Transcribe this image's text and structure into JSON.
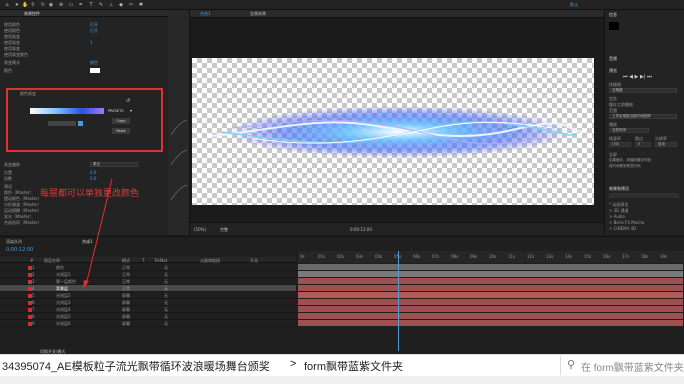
{
  "toolbar": {
    "left_icons": [
      "home-icon",
      "arrow-icon",
      "hand-icon",
      "zoom-icon",
      "rotate-icon",
      "camera-icon",
      "pan-icon",
      "rect-icon",
      "pen-icon",
      "text-icon",
      "brush-icon",
      "stamp-icon",
      "eraser-icon",
      "roto-icon",
      "puppet-icon"
    ],
    "right_label": "默认"
  },
  "effects": {
    "tab_label": "效果控件",
    "rows": [
      {
        "label": "使用颜色",
        "value": "打开"
      },
      {
        "label": "使用颜色",
        "value": "打开"
      },
      {
        "label": "使用渐变",
        "value": ""
      },
      {
        "label": "使用渐变",
        "value": "1"
      },
      {
        "label": "使用渐变",
        "value": ""
      },
      {
        "label": "使用渐变颜色",
        "value": ""
      },
      {
        "label": "渐变模式",
        "value": "颜色"
      },
      {
        "label": "颜色",
        "value": ""
      }
    ],
    "gradient_label": "颜色渐变",
    "presets_label": "PRESETS",
    "copy_label": "Copy",
    "paste_label": "Paste",
    "lower_rows": [
      {
        "label": "渐变偏移",
        "value": "0.0"
      },
      {
        "label": "位置",
        "value": "0.0"
      },
      {
        "label": "倍数",
        "value": "0.0"
      },
      {
        "label": "预设",
        "value": ""
      },
      {
        "label": "颜色（Master）",
        "value": ""
      },
      {
        "label": "摆动颜色（Master）",
        "value": ""
      },
      {
        "label": "分形噪波（Master）",
        "value": ""
      },
      {
        "label": "运动模糊（Master）",
        "value": ""
      },
      {
        "label": "发光（Master）",
        "value": ""
      },
      {
        "label": "合成选项（Master）",
        "value": ""
      }
    ],
    "select_value": "柔光"
  },
  "annotation": "每层都可以单独更改颜色",
  "composition": {
    "tab": "合成1",
    "tab2": "金属效果",
    "zoom": "(50%)",
    "quality": "完整",
    "timecode": "0:00:12:00"
  },
  "right_panel": {
    "info_title": "信息",
    "audio_title": "音频",
    "preview_title": "预览",
    "shortcut_label": "快捷键",
    "shortcut_value": "空格键",
    "include_label": "包含",
    "cache_label": "缓存之前播放",
    "range_label": "范围",
    "range_value": "工作区域按当前时间延伸",
    "play_label": "播放",
    "play_value": "当前时间",
    "fps_label": "帧速率",
    "fps_value": "(30)",
    "skip_label": "跳过",
    "skip_value": "0",
    "res_label": "分辨率",
    "res_value": "自动",
    "fullscreen_label": "全屏",
    "stop_label": "如果缓存，则播放缓存的帧",
    "move_label": "将时间移到预览时间",
    "effects_title": "效果和预设",
    "effects_items": [
      "* 动画预设",
      "> 3D 通道",
      "> Audio",
      "> Boris FX Mocha",
      "> CINEMA 4D"
    ]
  },
  "timeline": {
    "project_tab": "渲染队列",
    "comp_tab": "合成1",
    "timecode": "0:00:12:00",
    "header": [
      "#",
      "图层名称",
      "模式",
      "T",
      "TrkMat",
      "父级和链接",
      "开关"
    ],
    "layers": [
      {
        "num": "1",
        "name": "颜色",
        "mode": "正常",
        "parent": "无"
      },
      {
        "num": "2",
        "name": "光线层1",
        "mode": "正常",
        "parent": "无"
      },
      {
        "num": "3",
        "name": "第一层颜色",
        "mode": "正常",
        "parent": "无"
      },
      {
        "num": "4",
        "name": "背景层",
        "mode": "正常",
        "parent": "无"
      },
      {
        "num": "5",
        "name": "光线层2",
        "mode": "屏幕",
        "parent": "无"
      },
      {
        "num": "6",
        "name": "光线层3",
        "mode": "屏幕",
        "parent": "无"
      },
      {
        "num": "7",
        "name": "光线层4",
        "mode": "屏幕",
        "parent": "无"
      },
      {
        "num": "8",
        "name": "光线层5",
        "mode": "屏幕",
        "parent": "无"
      },
      {
        "num": "9",
        "name": "光线层6",
        "mode": "屏幕",
        "parent": "无"
      }
    ],
    "ruler": [
      "0s",
      "01s",
      "02s",
      "03s",
      "04s",
      "05s",
      "06s",
      "07s",
      "08s",
      "09s",
      "10s",
      "11s",
      "12s",
      "13s",
      "14s",
      "15s",
      "16s",
      "17s",
      "18s",
      "19s",
      "20s"
    ],
    "footer": "切换开关/模式"
  },
  "path": {
    "folder1": "34395074_AE模板粒子流光飘带循环波浪暖场舞台颁奖",
    "sep": ">",
    "folder2": "form飘带蓝紫文件夹",
    "search_placeholder": "在 form飘带蓝紫文件夹 中搜索"
  }
}
